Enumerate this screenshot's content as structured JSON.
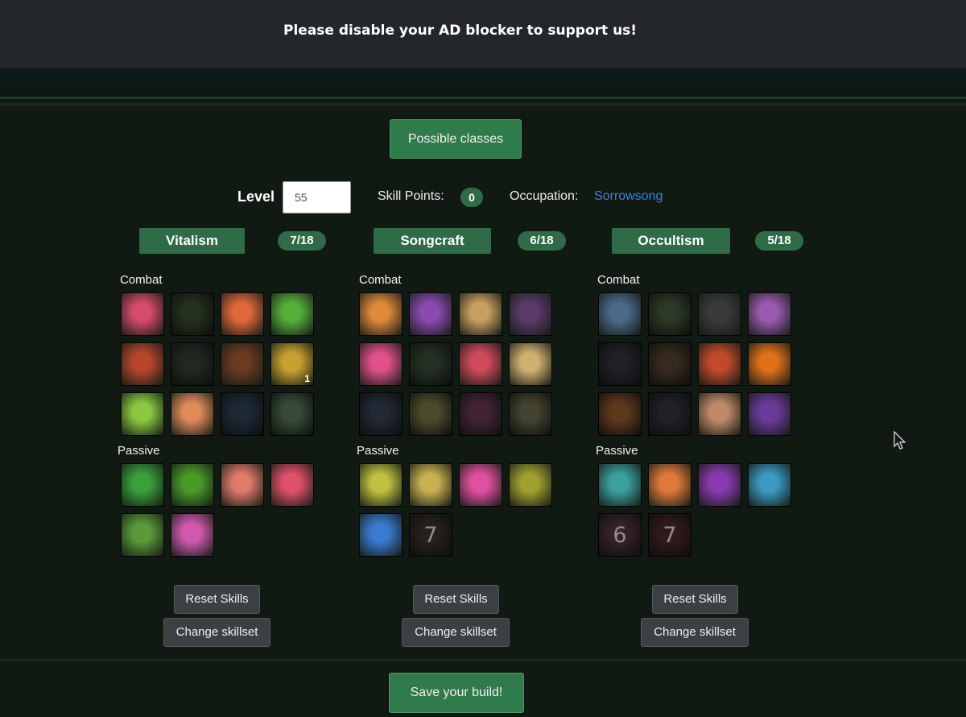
{
  "banner": {
    "message": "Please disable your AD blocker to support us!"
  },
  "possible_classes_label": "Possible classes",
  "level": {
    "label": "Level",
    "value": "55"
  },
  "skill_points": {
    "label": "Skill Points:",
    "value": "0"
  },
  "occupation": {
    "label": "Occupation:",
    "value": "Sorrowsong"
  },
  "trees": [
    {
      "name": "Vitalism",
      "points": "7/18",
      "combat_label": "Combat",
      "passive_label": "Passive",
      "combat": [
        {
          "icon": "burst-icon",
          "color": "#d64a6a",
          "dim": false
        },
        {
          "icon": "vines-icon",
          "color": "#3c5a2c",
          "dim": true
        },
        {
          "icon": "raised-hand-icon",
          "color": "#e0683a",
          "dim": false
        },
        {
          "icon": "silhouette-icon",
          "color": "#56b03a",
          "dim": false
        },
        {
          "icon": "spear-icon",
          "color": "#b5462c",
          "dim": false
        },
        {
          "icon": "figures-icon",
          "color": "#3a4a38",
          "dim": true
        },
        {
          "icon": "cross-icon",
          "color": "#6a3a22",
          "dim": false
        },
        {
          "icon": "plus-icon",
          "color": "#c8a030",
          "dim": false,
          "sub": "1"
        },
        {
          "icon": "seed-icon",
          "color": "#8cc840",
          "dim": false
        },
        {
          "icon": "radiant-figure-icon",
          "color": "#e08a5a",
          "dim": false
        },
        {
          "icon": "hands-icon",
          "color": "#2c4a70",
          "dim": true
        },
        {
          "icon": "glow-icon",
          "color": "#5a8a5a",
          "dim": true
        }
      ],
      "passive": [
        {
          "icon": "green-burst-icon",
          "color": "#3aa03a",
          "dim": false
        },
        {
          "icon": "claw-icon",
          "color": "#4a9a2a",
          "dim": false
        },
        {
          "icon": "heart-hands-icon",
          "color": "#e07a6a",
          "dim": false
        },
        {
          "icon": "heart-hand-icon",
          "color": "#e0506a",
          "dim": false
        },
        {
          "icon": "heart-outline-icon",
          "color": "#5a9a3a",
          "dim": false
        },
        {
          "icon": "pink-heart-icon",
          "color": "#d05ab0",
          "dim": false
        }
      ],
      "reset_label": "Reset Skills",
      "change_label": "Change skillset"
    },
    {
      "name": "Songcraft",
      "points": "6/18",
      "combat_label": "Combat",
      "passive_label": "Passive",
      "combat": [
        {
          "icon": "tuning-fork-icon",
          "color": "#e08a3a",
          "dim": false
        },
        {
          "icon": "note-wave-icon",
          "color": "#8a4ab0",
          "dim": false
        },
        {
          "icon": "treble-clef-icon",
          "color": "#c8a060",
          "dim": false
        },
        {
          "icon": "screaming-face-icon",
          "color": "#5a3a6a",
          "dim": false
        },
        {
          "icon": "dancing-foot-icon",
          "color": "#e0508a",
          "dim": false
        },
        {
          "icon": "clef-icon",
          "color": "#3a5a3a",
          "dim": true
        },
        {
          "icon": "music-notes-icon",
          "color": "#d04a5a",
          "dim": false
        },
        {
          "icon": "clef-notes-icon",
          "color": "#d0b070",
          "dim": false
        },
        {
          "icon": "harp-icon",
          "color": "#3a4a6a",
          "dim": true
        },
        {
          "icon": "horn-icon",
          "color": "#8a8a3a",
          "dim": true
        },
        {
          "icon": "sword-icon",
          "color": "#8a3a6a",
          "dim": true
        },
        {
          "icon": "skull-figure-icon",
          "color": "#7a7a4a",
          "dim": true
        }
      ],
      "passive": [
        {
          "icon": "dual-clef-icon",
          "color": "#c0c040",
          "dim": false
        },
        {
          "icon": "hourglass-icon",
          "color": "#c8b050",
          "dim": false
        },
        {
          "icon": "pink-streak-icon",
          "color": "#e050a0",
          "dim": false
        },
        {
          "icon": "lute-icon",
          "color": "#a0a030",
          "dim": false
        },
        {
          "icon": "blue-hand-icon",
          "color": "#3a7ad0",
          "dim": false
        },
        {
          "icon": "locked-seven-icon",
          "color": "#4a3a2a",
          "dim": true,
          "number": "7"
        }
      ],
      "reset_label": "Reset Skills",
      "change_label": "Change skillset"
    },
    {
      "name": "Occultism",
      "points": "5/18",
      "combat_label": "Combat",
      "passive_label": "Passive",
      "combat": [
        {
          "icon": "dark-hand-icon",
          "color": "#4a6a8a",
          "dim": false
        },
        {
          "icon": "claw-grass-icon",
          "color": "#4a6a3a",
          "dim": true
        },
        {
          "icon": "cowl-icon",
          "color": "#3a3a3a",
          "dim": false
        },
        {
          "icon": "coffin-icon",
          "color": "#9a5ab0",
          "dim": false
        },
        {
          "icon": "shadow-figure-icon",
          "color": "#3a3a4a",
          "dim": true
        },
        {
          "icon": "web-icon",
          "color": "#6a4a2a",
          "dim": true
        },
        {
          "icon": "demon-eye-icon",
          "color": "#c04a2a",
          "dim": false
        },
        {
          "icon": "fire-figure-icon",
          "color": "#e0701a",
          "dim": false
        },
        {
          "icon": "orange-eye-icon",
          "color": "#c0601a",
          "dim": true
        },
        {
          "icon": "hooded-icon",
          "color": "#3a3a4a",
          "dim": true
        },
        {
          "icon": "skull-icon",
          "color": "#c08a6a",
          "dim": false
        },
        {
          "icon": "purple-figure-icon",
          "color": "#6a3a9a",
          "dim": false
        }
      ],
      "passive": [
        {
          "icon": "teal-swirl-icon",
          "color": "#3aa0a0",
          "dim": false
        },
        {
          "icon": "flame-burst-icon",
          "color": "#e07a3a",
          "dim": false
        },
        {
          "icon": "hooded-woman-icon",
          "color": "#8a3ab0",
          "dim": false
        },
        {
          "icon": "spiral-icon",
          "color": "#3a9ac0",
          "dim": false
        },
        {
          "icon": "locked-six-icon",
          "color": "#6a3a4a",
          "dim": true,
          "number": "6"
        },
        {
          "icon": "locked-seven-icon",
          "color": "#6a2a2a",
          "dim": true,
          "number": "7"
        }
      ],
      "reset_label": "Reset Skills",
      "change_label": "Change skillset"
    }
  ],
  "save_label": "Save your build!"
}
